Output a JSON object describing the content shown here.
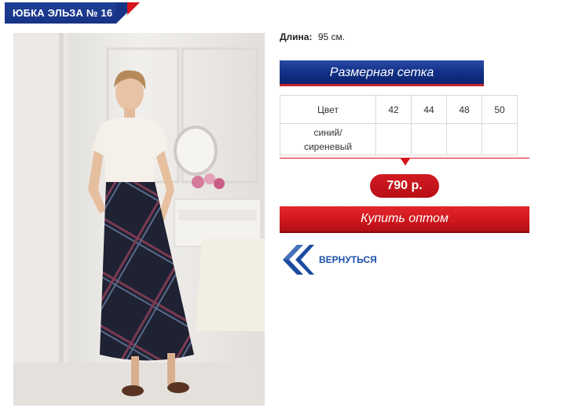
{
  "header": {
    "title": "ЮБКА ЭЛЬЗА № 16"
  },
  "product": {
    "photo_alt": "product-photo",
    "length_label": "Длина:",
    "length_value": "95 см.",
    "size_chart_button": "Размерная сетка",
    "sizes_table": {
      "header": [
        "Цвет",
        "42",
        "44",
        "48",
        "50"
      ],
      "rows": [
        [
          "синий/ сиреневый",
          "",
          "",
          "",
          ""
        ]
      ]
    },
    "price": "790 р.",
    "buy_button": "Купить оптом",
    "back_link": "ВЕРНУТЬСЯ"
  },
  "colors": {
    "brand_blue": "#163385",
    "accent_red": "#d6141a",
    "link_blue": "#1d4fa8"
  }
}
